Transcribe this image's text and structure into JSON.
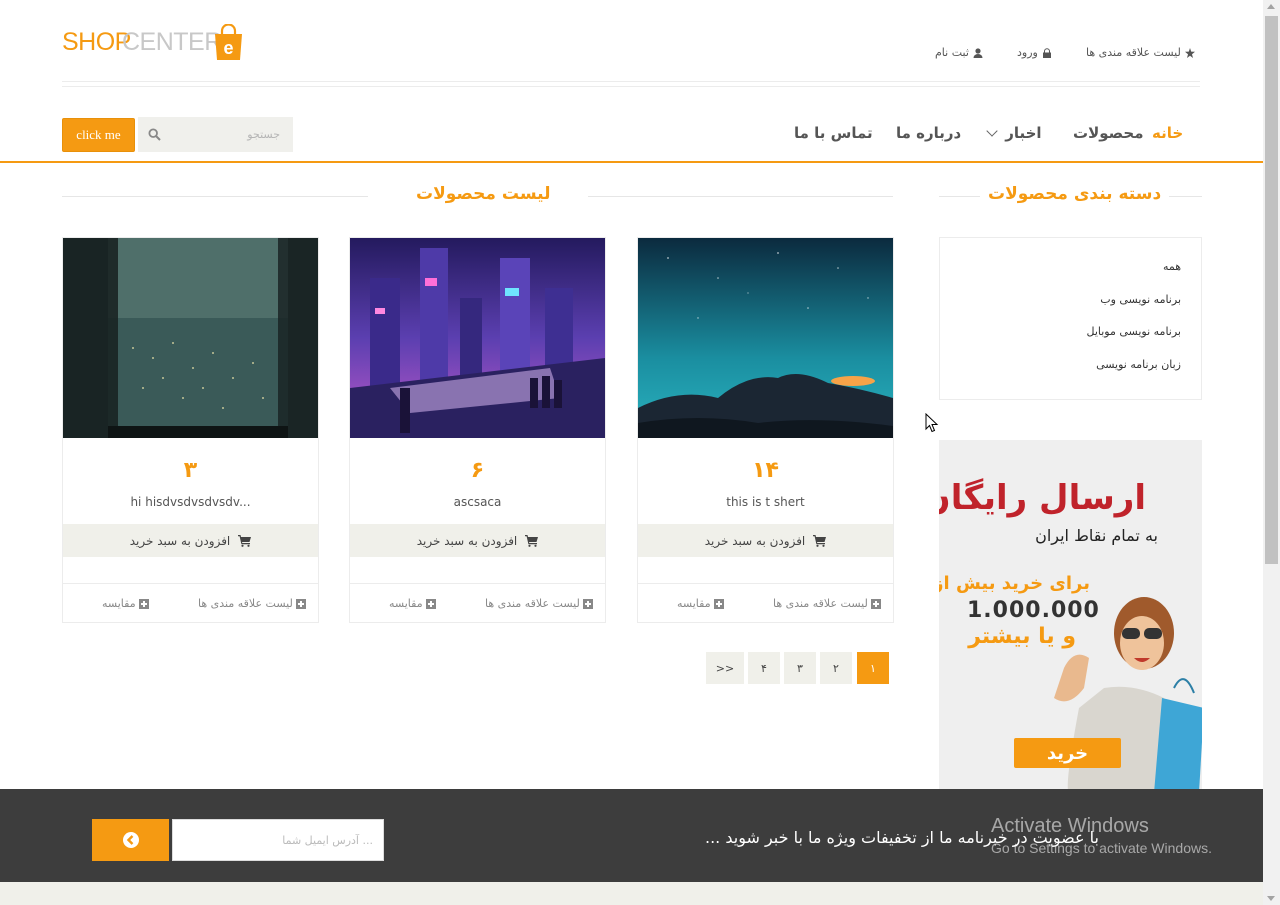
{
  "logo": {
    "shop": "SHOP",
    "center": "CENTER",
    "badge": "e"
  },
  "toplinks": {
    "wishlist": "لیست علاقه مندی ها",
    "login": "ورود",
    "register": "ثبت نام"
  },
  "nav": {
    "home": "خانه",
    "products": "محصولات",
    "news": "اخبار",
    "about": "درباره ما",
    "contact": "تماس با ما"
  },
  "search": {
    "placeholder": "جستجو",
    "button": "click me"
  },
  "sidebar": {
    "title": "دسته بندی محصولات",
    "categories": [
      "همه",
      "برنامه نویسی وب",
      "برنامه نویسی موبایل",
      "زبان برنامه نویسی"
    ]
  },
  "ad": {
    "title": "ارسال رایگان",
    "subtitle": "به تمام نقاط ایران",
    "line1": "برای خرید بیش از",
    "amount": "1.000.000",
    "line3": "و یا بیشتر",
    "button": "خرید"
  },
  "products": {
    "title": "لیست محصولات",
    "items": [
      {
        "price": "۱۴",
        "name": "this is t shert"
      },
      {
        "price": "۶",
        "name": "ascsaca"
      },
      {
        "price": "۳",
        "name": "hi hisdvsdvsdvsdv..."
      }
    ],
    "add_to_cart": "افزودن به سبد خرید",
    "wishlist": "لیست علاقه مندی ها",
    "compare": "مقایسه"
  },
  "pagination": {
    "pages": [
      "۱",
      "۲",
      "۳",
      "۴"
    ],
    "next": ">>",
    "active": "۱"
  },
  "footer": {
    "text": "با عضویت در خبرنامه ما از تخفیفات ویژه ما با خبر شوید ...",
    "email_placeholder": "آدرس ایمیل شما ..."
  },
  "watermark": {
    "line1": "Activate Windows",
    "line2": "Go to Settings to activate Windows."
  },
  "colors": {
    "accent": "#f59a12",
    "footer_bg": "#3d3d3d",
    "light_bg": "#f0f0ea"
  }
}
